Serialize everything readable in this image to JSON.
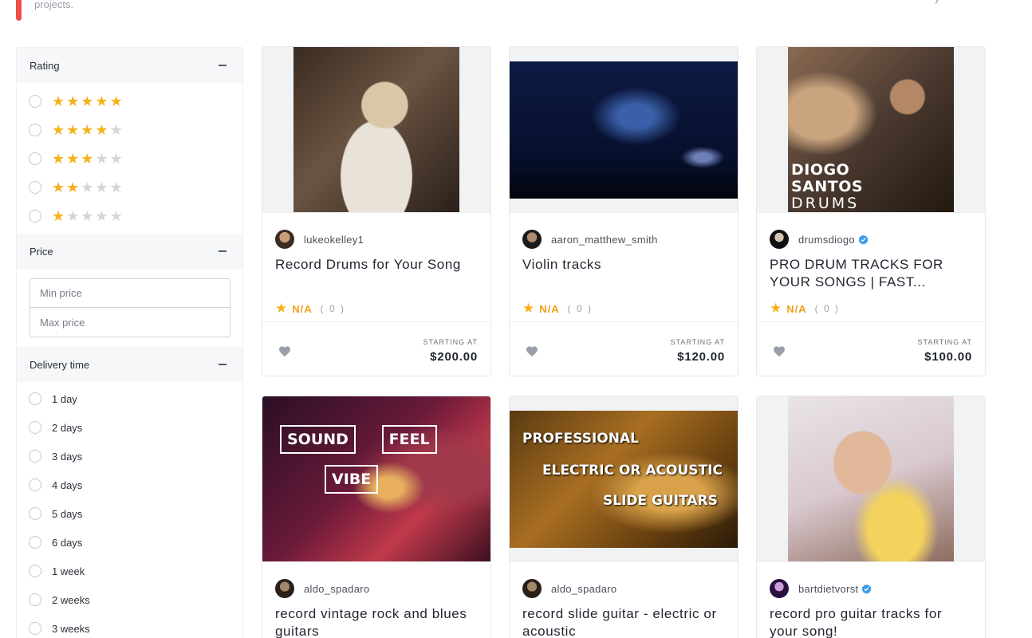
{
  "banner": {
    "text": "projects.",
    "right_text": "y"
  },
  "filters": {
    "rating": {
      "title": "Rating",
      "options": [
        5,
        4,
        3,
        2,
        1
      ]
    },
    "price": {
      "title": "Price",
      "min_placeholder": "Min price",
      "max_placeholder": "Max price"
    },
    "delivery": {
      "title": "Delivery time",
      "options": [
        "1 day",
        "2 days",
        "3 days",
        "4 days",
        "5 days",
        "6 days",
        "1 week",
        "2 weeks",
        "3 weeks"
      ]
    }
  },
  "cards": [
    {
      "seller": "lukeokelley1",
      "verified": false,
      "title": "Record Drums for Your Song",
      "rating": "N/A",
      "reviews": "( 0 )",
      "price_label": "STARTING AT",
      "price": "$200.00"
    },
    {
      "seller": "aaron_matthew_smith",
      "verified": false,
      "title": "Violin tracks",
      "rating": "N/A",
      "reviews": "( 0 )",
      "price_label": "STARTING AT",
      "price": "$120.00"
    },
    {
      "seller": "drumsdiogo",
      "verified": true,
      "title": "PRO DRUM TRACKS FOR YOUR SONGS | FAST...",
      "rating": "N/A",
      "reviews": "( 0 )",
      "price_label": "STARTING AT",
      "price": "$100.00",
      "thumb_text": [
        "DIOGO",
        "SANTOS",
        "DRUMS"
      ]
    },
    {
      "seller": "aldo_spadaro",
      "verified": false,
      "title": "record vintage rock and blues guitars",
      "thumb_text": [
        "SOUND",
        "FEEL",
        "VIBE"
      ]
    },
    {
      "seller": "aldo_spadaro",
      "verified": false,
      "title": "record slide guitar - electric or acoustic",
      "thumb_text": [
        "PROFESSIONAL",
        "ELECTRIC OR ACOUSTIC",
        "SLIDE GUITARS"
      ]
    },
    {
      "seller": "bartdietvorst",
      "verified": true,
      "title": "record pro guitar tracks for your song!"
    }
  ],
  "colors": {
    "accent_red": "#ee4b4b",
    "star": "#f6b11b",
    "rating_text": "#f0a017",
    "verified_blue": "#3b9be8"
  },
  "icons": {
    "collapse": "minus-icon",
    "favorite": "heart-icon",
    "verified": "verified-badge-icon",
    "rating": "star-icon"
  }
}
